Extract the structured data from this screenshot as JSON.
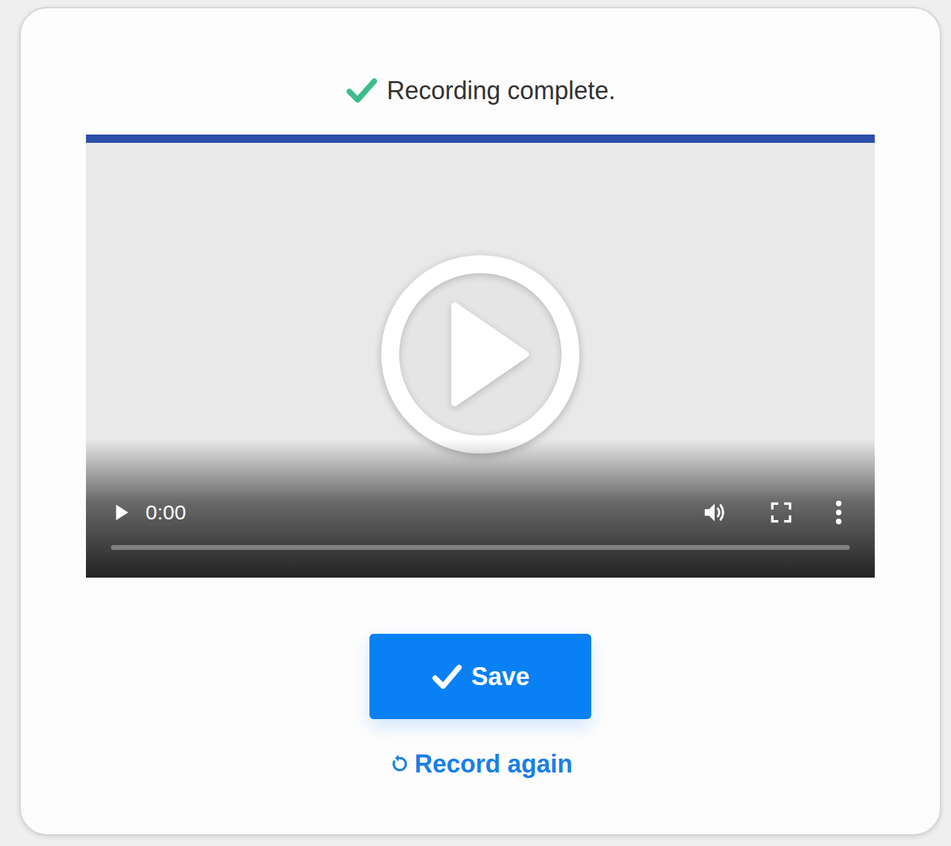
{
  "status": {
    "text": "Recording complete."
  },
  "video": {
    "time": "0:00",
    "playing": false,
    "muted": false,
    "progress": 0
  },
  "actions": {
    "save": "Save",
    "record_again": "Record again"
  }
}
